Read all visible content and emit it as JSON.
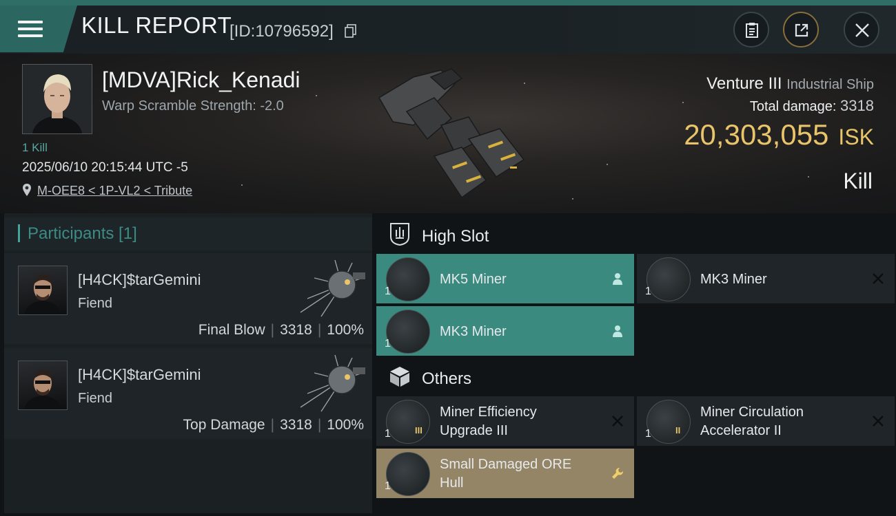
{
  "header": {
    "title": "KILL REPORT",
    "report_id": "[ID:10796592]"
  },
  "victim": {
    "name": "[MDVA]Rick_Kenadi",
    "warp_scramble": "Warp Scramble Strength: -2.0",
    "kill_count": "1 Kill",
    "datetime": "2025/06/10 20:15:44 UTC -5",
    "location": "M-OEE8 < 1P-VL2 < Tribute",
    "ship_name": "Venture III",
    "ship_class": "Industrial Ship",
    "total_damage_label": "Total damage:",
    "total_damage": "3318",
    "isk_value": "20,303,055",
    "isk_unit": "ISK",
    "result": "Kill"
  },
  "participants": {
    "title": "Participants [1]",
    "rows": [
      {
        "name": "[H4CK]$tarGemini",
        "ship": "Fiend",
        "role": "Final Blow",
        "damage": "3318",
        "percent": "100%"
      },
      {
        "name": "[H4CK]$tarGemini",
        "ship": "Fiend",
        "role": "Top Damage",
        "damage": "3318",
        "percent": "100%"
      }
    ]
  },
  "slots": {
    "high_slot_label": "High Slot",
    "others_label": "Others",
    "high": [
      {
        "name": "MK5 Miner",
        "qty": "1",
        "status": "dropped"
      },
      {
        "name": "MK3 Miner",
        "qty": "1",
        "status": "destroyed"
      },
      {
        "name": "MK3 Miner",
        "qty": "1",
        "status": "dropped"
      }
    ],
    "others": [
      {
        "name_line1": "Miner Efficiency",
        "name_line2": "Upgrade III",
        "qty": "1",
        "tier": "III",
        "status": "destroyed"
      },
      {
        "name_line1": "Miner Circulation",
        "name_line2": "Accelerator II",
        "qty": "1",
        "tier": "II",
        "status": "destroyed"
      },
      {
        "name_line1": "Small Damaged ORE",
        "name_line2": "Hull",
        "qty": "1",
        "status": "salvage"
      }
    ]
  },
  "colors": {
    "accent_teal": "#3a8a80",
    "isk_gold": "#e8c46a",
    "salvage_gold": "#948566"
  },
  "icons": [
    "menu-icon",
    "copy-icon",
    "clipboard-icon",
    "share-icon",
    "close-icon",
    "location-pin-icon",
    "high-slot-icon",
    "others-box-icon",
    "person-icon",
    "x-icon",
    "wrench-icon"
  ]
}
